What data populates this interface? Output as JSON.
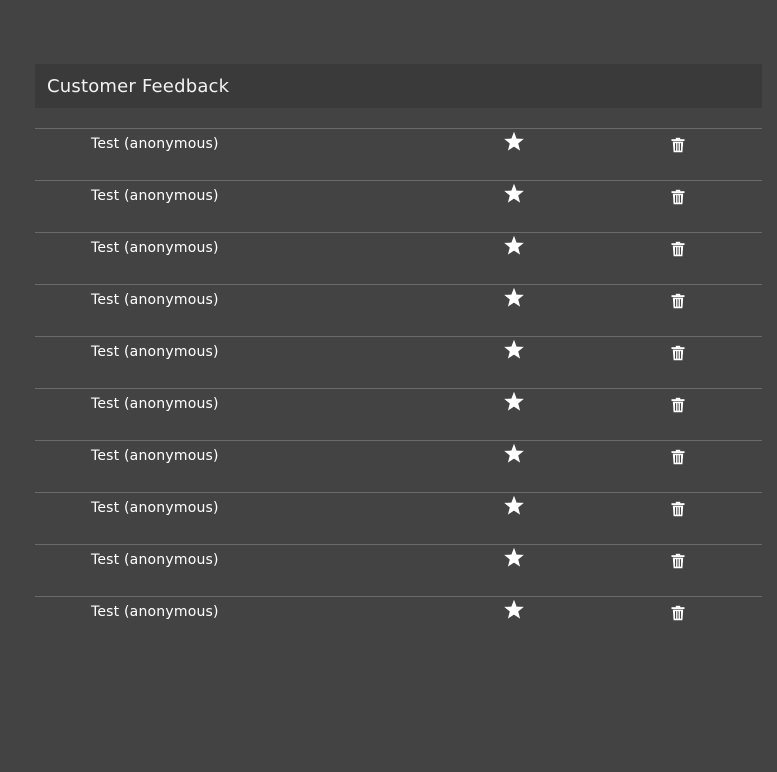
{
  "panel": {
    "title": "Customer Feedback"
  },
  "feedback": [
    {
      "label": "Test (anonymous)",
      "icon": "star-icon",
      "action_icon": "trash-icon"
    },
    {
      "label": "Test (anonymous)",
      "icon": "star-icon",
      "action_icon": "trash-icon"
    },
    {
      "label": "Test (anonymous)",
      "icon": "star-icon",
      "action_icon": "trash-icon"
    },
    {
      "label": "Test (anonymous)",
      "icon": "star-icon",
      "action_icon": "trash-icon"
    },
    {
      "label": "Test (anonymous)",
      "icon": "star-icon",
      "action_icon": "trash-icon"
    },
    {
      "label": "Test (anonymous)",
      "icon": "star-icon",
      "action_icon": "trash-icon"
    },
    {
      "label": "Test (anonymous)",
      "icon": "star-icon",
      "action_icon": "trash-icon"
    },
    {
      "label": "Test (anonymous)",
      "icon": "star-icon",
      "action_icon": "trash-icon"
    },
    {
      "label": "Test (anonymous)",
      "icon": "star-icon",
      "action_icon": "trash-icon"
    },
    {
      "label": "Test (anonymous)",
      "icon": "star-icon",
      "action_icon": "trash-icon"
    }
  ],
  "colors": {
    "background": "#434343",
    "header_background": "#3a3a3a",
    "divider": "#6a6a6a",
    "text": "#ffffff"
  }
}
